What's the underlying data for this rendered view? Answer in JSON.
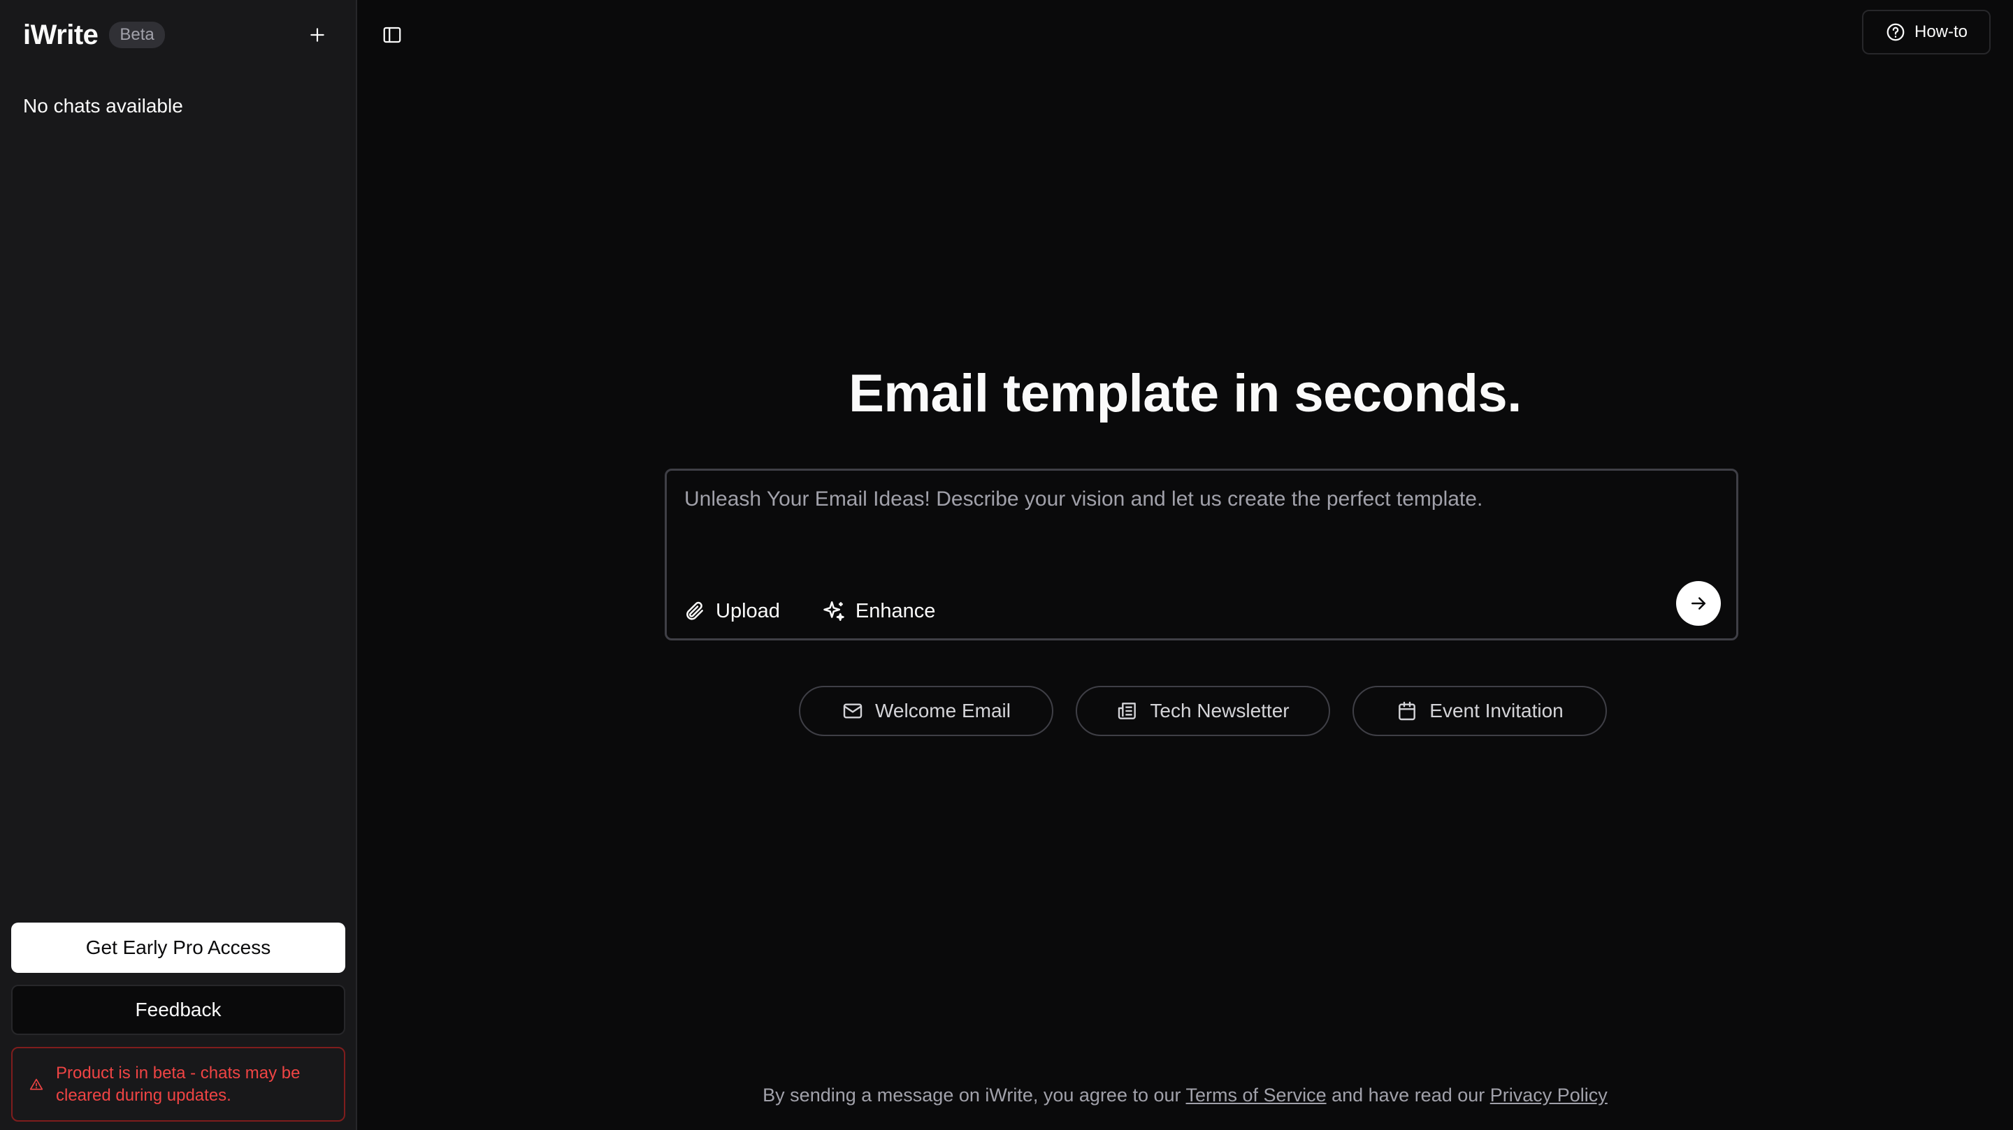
{
  "sidebar": {
    "brand": "iWrite",
    "badge": "Beta",
    "empty_state": "No chats available",
    "pro_button": "Get Early Pro Access",
    "feedback_button": "Feedback",
    "warning_line1": "Product is in beta - chats may be",
    "warning_line2": "cleared during updates."
  },
  "header": {
    "howto_label": "How-to"
  },
  "main": {
    "title": "Email template in seconds.",
    "composer": {
      "placeholder": "Unleash Your Email Ideas! Describe your vision and let us create the perfect template.",
      "value": "",
      "upload_label": "Upload",
      "enhance_label": "Enhance"
    },
    "suggestions": [
      {
        "label": "Welcome Email",
        "icon": "mail-icon"
      },
      {
        "label": "Tech Newsletter",
        "icon": "newspaper-icon"
      },
      {
        "label": "Event Invitation",
        "icon": "calendar-icon"
      }
    ]
  },
  "footer": {
    "text_before": "By sending a message on iWrite, you agree to our ",
    "terms_link": "Terms of Service",
    "text_middle": " and have read our ",
    "privacy_link": "Privacy Policy"
  },
  "colors": {
    "background": "#0a0a0b",
    "sidebar": "#18181a",
    "warning": "#ef4444"
  }
}
